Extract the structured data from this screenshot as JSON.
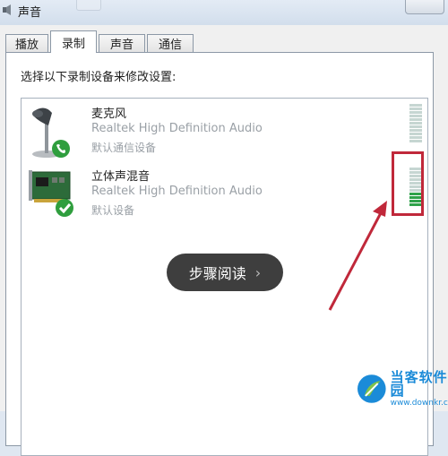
{
  "window": {
    "title": "声音"
  },
  "tabs": [
    {
      "label": "播放",
      "active": false
    },
    {
      "label": "录制",
      "active": true
    },
    {
      "label": "声音",
      "active": false
    },
    {
      "label": "通信",
      "active": false
    }
  ],
  "instruction": "选择以下录制设备来修改设置:",
  "devices": [
    {
      "name": "麦克风",
      "driver": "Realtek High Definition Audio",
      "status": "默认通信设备",
      "icon": "microphone-icon",
      "badge": "phone-badge-icon",
      "level_segments_lit": 0,
      "level_segments_total": 11
    },
    {
      "name": "立体声混音",
      "driver": "Realtek High Definition Audio",
      "status": "默认设备",
      "icon": "sound-card-icon",
      "badge": "check-badge-icon",
      "level_segments_lit": 4,
      "level_segments_total": 11
    }
  ],
  "overlay": {
    "step_button_label": "步骤阅读"
  },
  "watermark": {
    "title": "当客软件园",
    "url": "www.downkr.com"
  },
  "colors": {
    "highlight": "#c0283a",
    "meter_on": "#2fa24a",
    "meter_off": "#c6d6d2",
    "accent": "#1b8bd8"
  }
}
